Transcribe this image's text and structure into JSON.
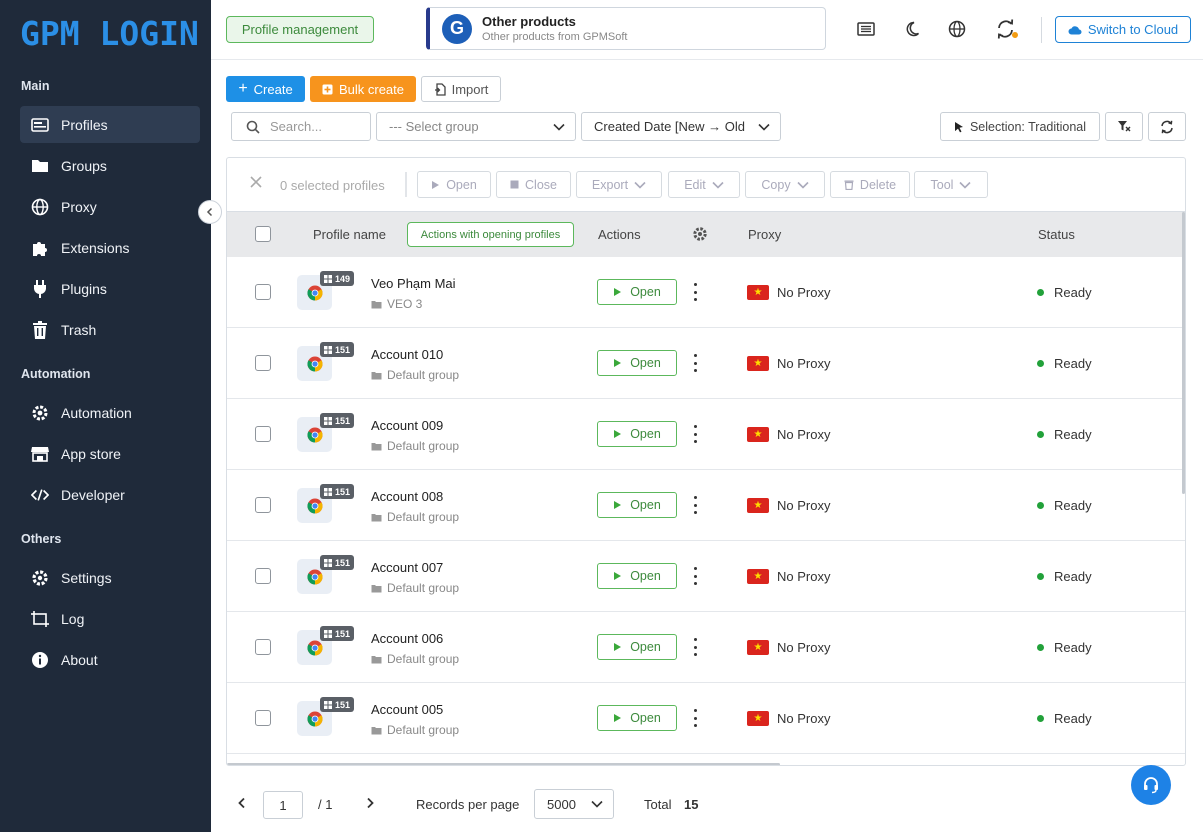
{
  "app": {
    "logo": "GPM LOGIN"
  },
  "sidebar": {
    "sections": [
      {
        "title": "Main"
      },
      {
        "title": "Automation"
      },
      {
        "title": "Others"
      }
    ],
    "items": [
      {
        "label": "Profiles",
        "icon": "profile-card-icon",
        "active": true
      },
      {
        "label": "Groups",
        "icon": "folder-icon"
      },
      {
        "label": "Proxy",
        "icon": "globe-icon"
      },
      {
        "label": "Extensions",
        "icon": "puzzle-icon"
      },
      {
        "label": "Plugins",
        "icon": "plug-icon"
      },
      {
        "label": "Trash",
        "icon": "trash-icon"
      },
      {
        "label": "Automation",
        "icon": "cog-icon"
      },
      {
        "label": "App store",
        "icon": "store-icon"
      },
      {
        "label": "Developer",
        "icon": "code-icon"
      },
      {
        "label": "Settings",
        "icon": "gear-icon"
      },
      {
        "label": "Log",
        "icon": "log-icon"
      },
      {
        "label": "About",
        "icon": "info-icon"
      }
    ]
  },
  "header": {
    "profile_management": "Profile management",
    "other_products": {
      "logo_letter": "G",
      "title": "Other products",
      "subtitle": "Other products from GPMSoft"
    },
    "switch_cloud": "Switch to Cloud",
    "accent": "#1e82d6"
  },
  "toolbar": {
    "create": "Create",
    "bulk_create": "Bulk create",
    "import": "Import",
    "search_placeholder": "Search...",
    "group_select": "--- Select group",
    "sort_select": "Created Date [New → Old",
    "selection_mode": "Selection: Traditional"
  },
  "selection_bar": {
    "count_text": "0  selected profiles",
    "open": "Open",
    "close": "Close",
    "export": "Export",
    "edit": "Edit",
    "copy": "Copy",
    "delete": "Delete",
    "tool": "Tool"
  },
  "table": {
    "headers": {
      "profile_name": "Profile name",
      "actions_opening": "Actions with opening profiles",
      "actions": "Actions",
      "proxy": "Proxy",
      "status": "Status"
    },
    "open_label": "Open",
    "rows": [
      {
        "version": "149",
        "name": "Veo Phạm Mai",
        "group": "VEO 3",
        "proxy": "No Proxy",
        "status": "Ready"
      },
      {
        "version": "151",
        "name": "Account 010",
        "group": "Default group",
        "proxy": "No Proxy",
        "status": "Ready"
      },
      {
        "version": "151",
        "name": "Account 009",
        "group": "Default group",
        "proxy": "No Proxy",
        "status": "Ready"
      },
      {
        "version": "151",
        "name": "Account 008",
        "group": "Default group",
        "proxy": "No Proxy",
        "status": "Ready"
      },
      {
        "version": "151",
        "name": "Account 007",
        "group": "Default group",
        "proxy": "No Proxy",
        "status": "Ready"
      },
      {
        "version": "151",
        "name": "Account 006",
        "group": "Default group",
        "proxy": "No Proxy",
        "status": "Ready"
      },
      {
        "version": "151",
        "name": "Account 005",
        "group": "Default group",
        "proxy": "No Proxy",
        "status": "Ready"
      }
    ]
  },
  "footer": {
    "page": "1",
    "of_pages": "/ 1",
    "records_label": "Records per page",
    "records_value": "5000",
    "total_label": "Total",
    "total_value": "15"
  }
}
